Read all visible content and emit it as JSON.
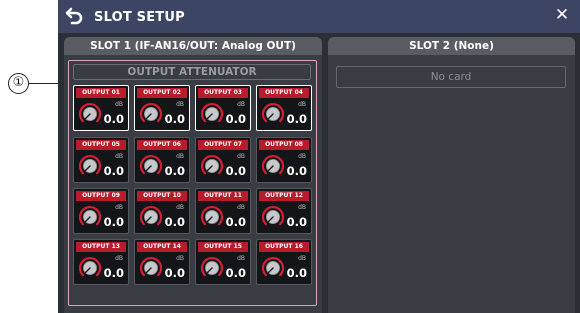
{
  "callout": {
    "number": "①"
  },
  "window": {
    "title": "SLOT SETUP",
    "back_icon": "back-arrow-icon",
    "close_icon": "close-icon",
    "close_glyph": "✕"
  },
  "slot1": {
    "header": "SLOT 1 (IF-AN16/OUT: Analog OUT)",
    "section_title": "OUTPUT ATTENUATOR",
    "outputs": [
      {
        "label": "OUTPUT 01",
        "unit": "dB",
        "value": "0.0",
        "selected": true
      },
      {
        "label": "OUTPUT 02",
        "unit": "dB",
        "value": "0.0",
        "selected": true
      },
      {
        "label": "OUTPUT 03",
        "unit": "dB",
        "value": "0.0",
        "selected": true
      },
      {
        "label": "OUTPUT 04",
        "unit": "dB",
        "value": "0.0",
        "selected": true
      },
      {
        "label": "OUTPUT 05",
        "unit": "dB",
        "value": "0.0",
        "selected": false
      },
      {
        "label": "OUTPUT 06",
        "unit": "dB",
        "value": "0.0",
        "selected": false
      },
      {
        "label": "OUTPUT 07",
        "unit": "dB",
        "value": "0.0",
        "selected": false
      },
      {
        "label": "OUTPUT 08",
        "unit": "dB",
        "value": "0.0",
        "selected": false
      },
      {
        "label": "OUTPUT 09",
        "unit": "dB",
        "value": "0.0",
        "selected": false
      },
      {
        "label": "OUTPUT 10",
        "unit": "dB",
        "value": "0.0",
        "selected": false
      },
      {
        "label": "OUTPUT 11",
        "unit": "dB",
        "value": "0.0",
        "selected": false
      },
      {
        "label": "OUTPUT 12",
        "unit": "dB",
        "value": "0.0",
        "selected": false
      },
      {
        "label": "OUTPUT 13",
        "unit": "dB",
        "value": "0.0",
        "selected": false
      },
      {
        "label": "OUTPUT 14",
        "unit": "dB",
        "value": "0.0",
        "selected": false
      },
      {
        "label": "OUTPUT 15",
        "unit": "dB",
        "value": "0.0",
        "selected": false
      },
      {
        "label": "OUTPUT 16",
        "unit": "dB",
        "value": "0.0",
        "selected": false
      }
    ]
  },
  "slot2": {
    "header": "SLOT 2 (None)",
    "status": "No card"
  },
  "colors": {
    "titlebar": "#3c4664",
    "output_label": "#b81c2c",
    "knob_ring": "#d61e35",
    "highlight": "#e0a8b6"
  }
}
